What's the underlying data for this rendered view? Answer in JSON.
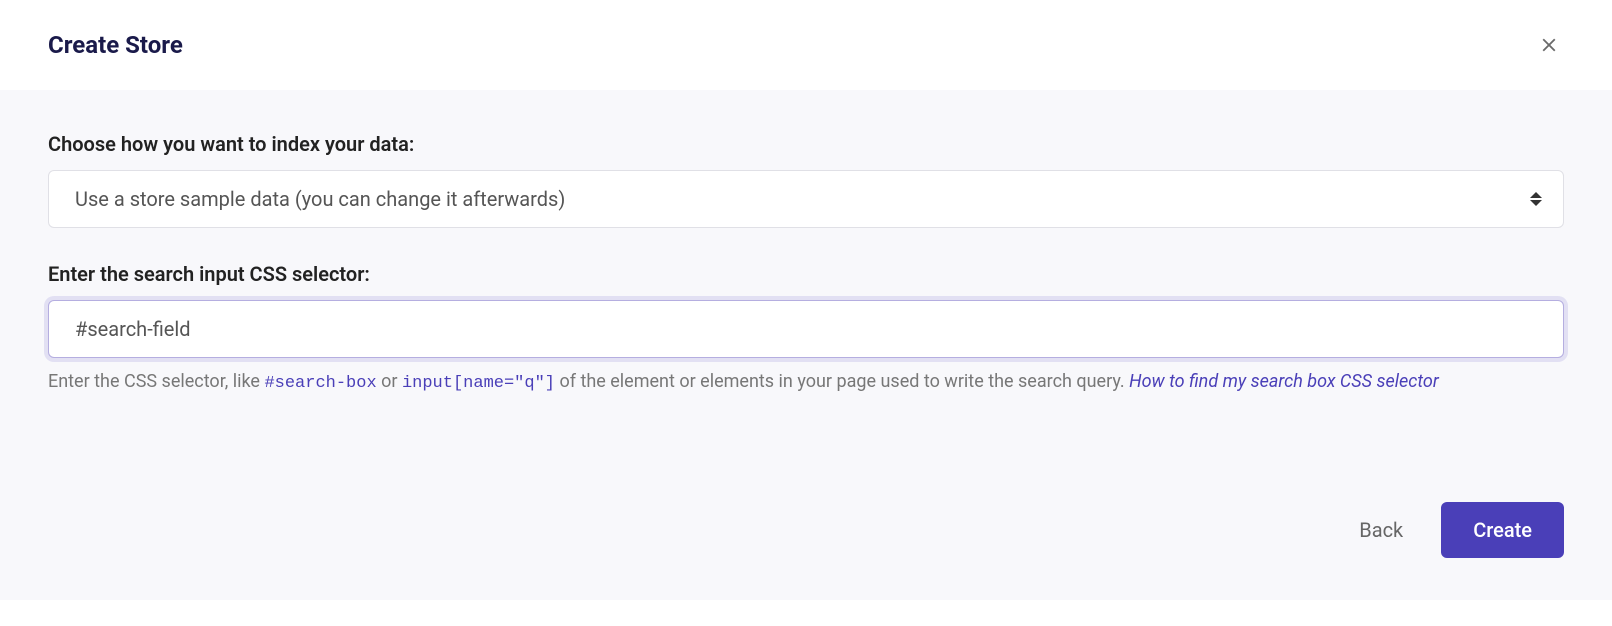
{
  "header": {
    "title": "Create Store"
  },
  "form": {
    "index_label": "Choose how you want to index your data:",
    "index_select_value": "Use a store sample data (you can change it afterwards)",
    "selector_label": "Enter the search input CSS selector:",
    "selector_input_value": "#search-field",
    "help_text_prefix": "Enter the CSS selector, like ",
    "help_code_1": "#search-box",
    "help_text_or": " or ",
    "help_code_2": "input[name=\"q\"]",
    "help_text_suffix": " of the element or elements in your page used to write the search query. ",
    "help_link_text": "How to find my search box CSS selector"
  },
  "footer": {
    "back_label": "Back",
    "create_label": "Create"
  }
}
